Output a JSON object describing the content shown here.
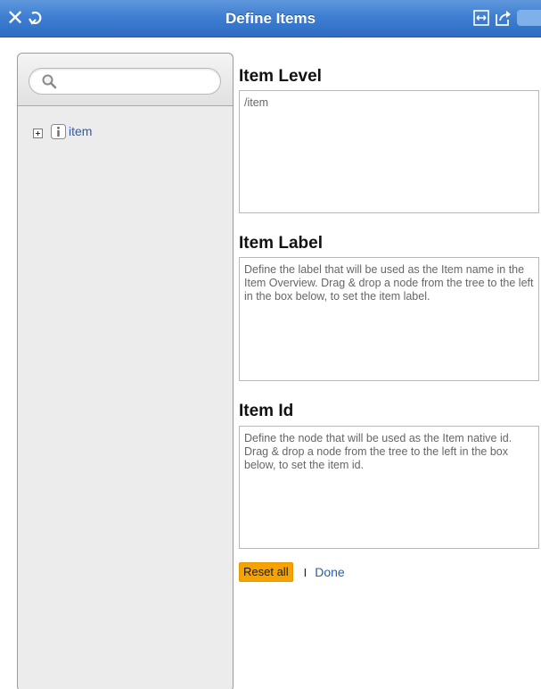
{
  "titlebar": {
    "title": "Define Items",
    "icons": [
      "close-icon",
      "refresh-icon",
      "fit-width-icon",
      "share-icon"
    ],
    "color": "#3f7fd2"
  },
  "tree": {
    "search_placeholder": "",
    "items": [
      {
        "label": "item",
        "icon": "info-icon",
        "expand_icon": "plus-box-icon"
      }
    ]
  },
  "form": {
    "item_level": {
      "heading": "Item Level",
      "value": "/item"
    },
    "item_label": {
      "heading": "Item Label",
      "value": "Define the label that will be used as the Item name in the Item Overview. Drag & drop a node from the tree to the left in the box below, to set the item label."
    },
    "item_id": {
      "heading": "Item Id",
      "value": "Define the node that will be used as the Item native id. Drag & drop a node from the tree to the left in the box below, to set the item id."
    }
  },
  "actions": {
    "reset_label": "Reset all",
    "separator": "I",
    "done_label": "Done",
    "reset_color": "#f6a300",
    "link_color": "#2a5db0"
  }
}
